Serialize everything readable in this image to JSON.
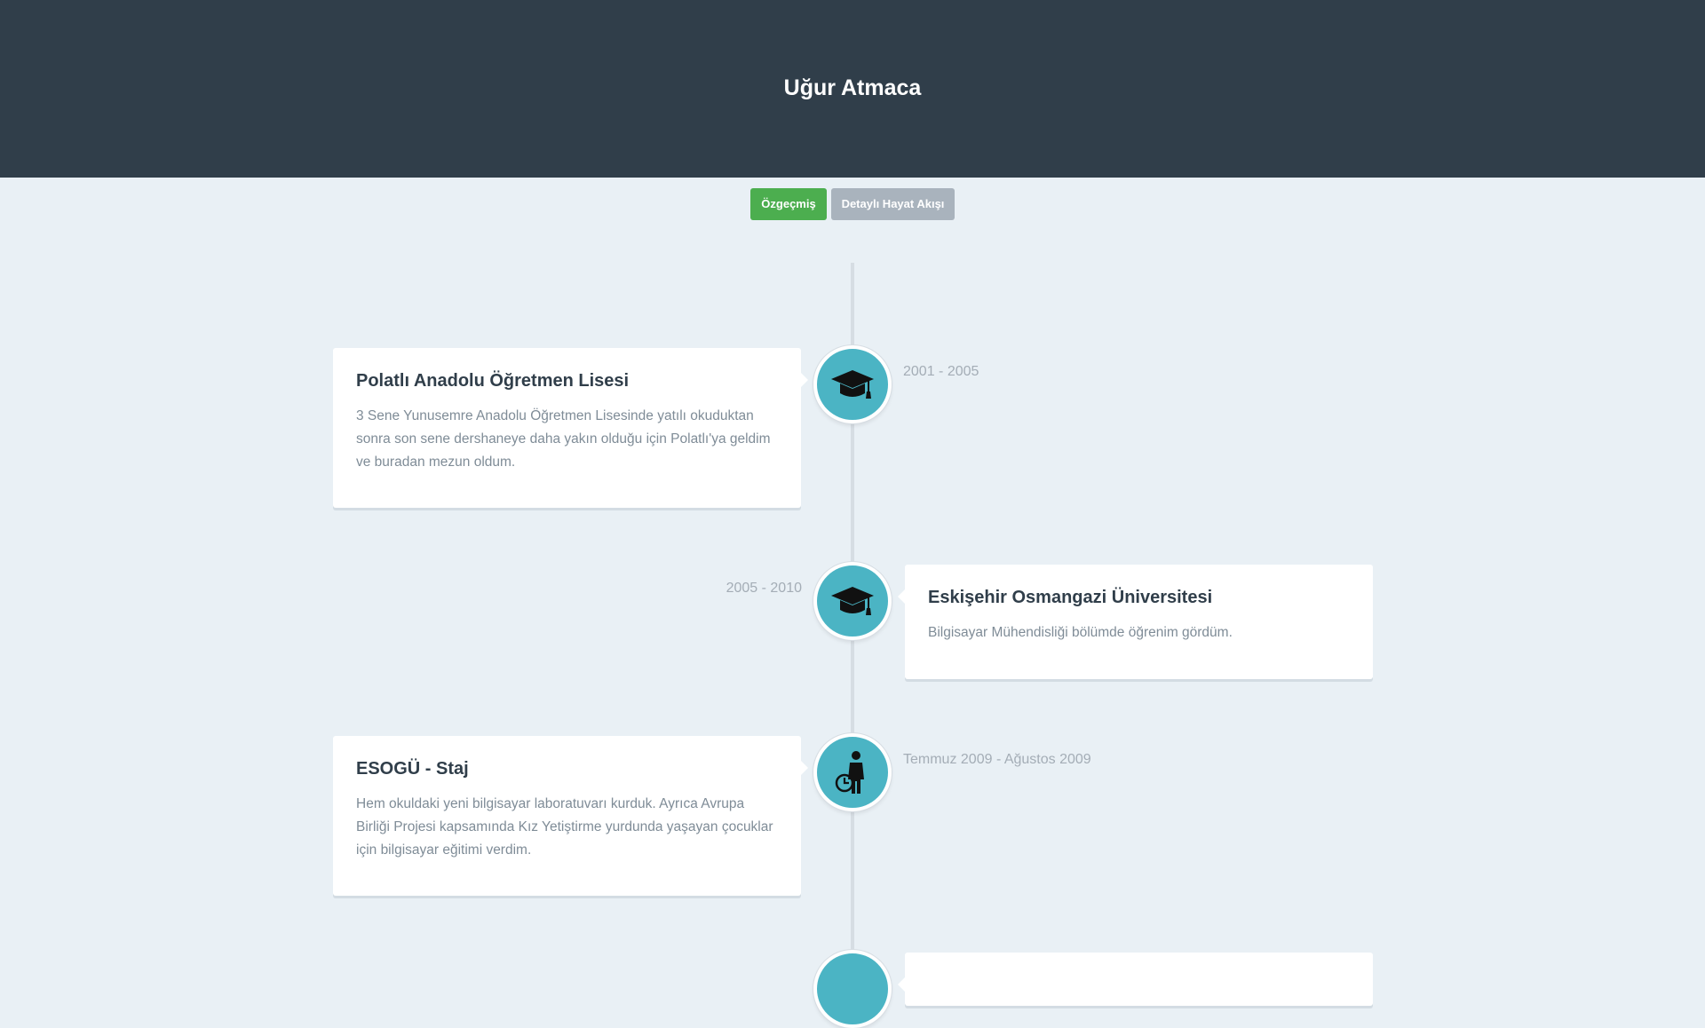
{
  "header": {
    "title": "Uğur Atmaca"
  },
  "buttons": {
    "resume_label": "Özgeçmiş",
    "lifeflow_label": "Detaylı Hayat Akışı"
  },
  "timeline": {
    "items": [
      {
        "title": "Polatlı Anadolu Öğretmen Lisesi",
        "description": "3 Sene Yunusemre Anadolu Öğretmen Lisesinde yatılı okuduktan sonra son sene dershaneye daha yakın olduğu için Polatlı'ya geldim ve buradan mezun oldum.",
        "date": "2001 - 2005",
        "icon": "graduation-cap-icon"
      },
      {
        "title": "Eskişehir Osmangazi Üniversitesi",
        "description": "Bilgisayar Mühendisliği bölümde öğrenim gördüm.",
        "date": "2005 - 2010",
        "icon": "graduation-cap-icon"
      },
      {
        "title": "ESOGÜ - Staj",
        "description": "Hem okuldaki yeni bilgisayar laboratuvarı kurduk. Ayrıca Avrupa Birliği Projesi kapsamında Kız Yetiştirme yurdunda yaşayan çocuklar için bilgisayar eğitimi verdim.",
        "date": "Temmuz 2009 - Ağustos 2009",
        "icon": "businessman-clock-icon"
      }
    ]
  },
  "colors": {
    "header_bg": "#303e4a",
    "page_bg": "#e9f0f5",
    "accent_green": "#4cae4f",
    "secondary_gray": "#a9b3bd",
    "icon_teal": "#4bb4c4"
  }
}
